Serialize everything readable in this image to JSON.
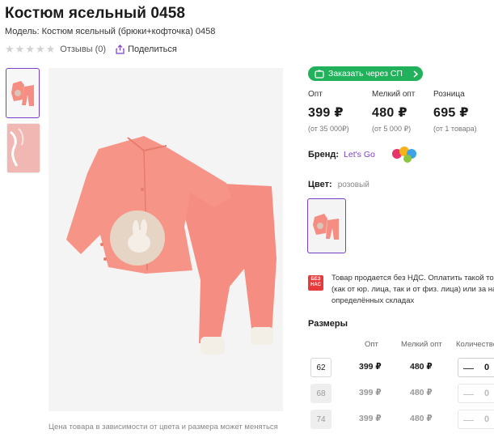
{
  "product": {
    "title": "Костюм ясельный 0458",
    "model": "Модель: Костюм ясельный (брюки+кофточка) 0458",
    "reviews": "Отзывы (0)",
    "share": "Поделиться",
    "rating_stars": 0
  },
  "gallery": {
    "note": "Цена товара в зависимости от цвета и размера может меняться"
  },
  "order_button": {
    "label": "Заказать через СП"
  },
  "prices": [
    {
      "label": "Опт",
      "value": "399 ₽",
      "note": "(от 35 000₽)"
    },
    {
      "label": "Мелкий опт",
      "value": "480 ₽",
      "note": "(от 5 000 ₽)"
    },
    {
      "label": "Розница",
      "value": "695 ₽",
      "note": "(от 1 товара)"
    }
  ],
  "brand": {
    "label": "Бренд:",
    "name": "Let's Go"
  },
  "color": {
    "label": "Цвет:",
    "value": "розовый"
  },
  "vat": {
    "icon_text": "БЕЗ НАС",
    "lines": [
      "Товар продается без НДС. Оплатить такой тов",
      "(как от юр. лица, так и от физ. лица) или за на",
      "определённых складах"
    ]
  },
  "sizes": {
    "title": "Размеры",
    "headers": {
      "opt": "Опт",
      "small_opt": "Мелкий опт",
      "qty": "Количество"
    },
    "rows": [
      {
        "size": "62",
        "opt": "399 ₽",
        "small_opt": "480 ₽",
        "qty": "0",
        "minus": "—",
        "enabled": true
      },
      {
        "size": "68",
        "opt": "399 ₽",
        "small_opt": "480 ₽",
        "qty": "0",
        "minus": "—",
        "enabled": false
      },
      {
        "size": "74",
        "opt": "399 ₽",
        "small_opt": "480 ₽",
        "qty": "0",
        "minus": "—",
        "enabled": false
      }
    ]
  },
  "colors": {
    "accent": "#7b3fc7",
    "green": "#20b15a",
    "vat_red": "#e73a3a",
    "garment": "#f58d82"
  },
  "icons": {
    "star": "star-icon",
    "share": "share-icon",
    "cart": "cart-icon",
    "chevron": "chevron-right-icon"
  }
}
